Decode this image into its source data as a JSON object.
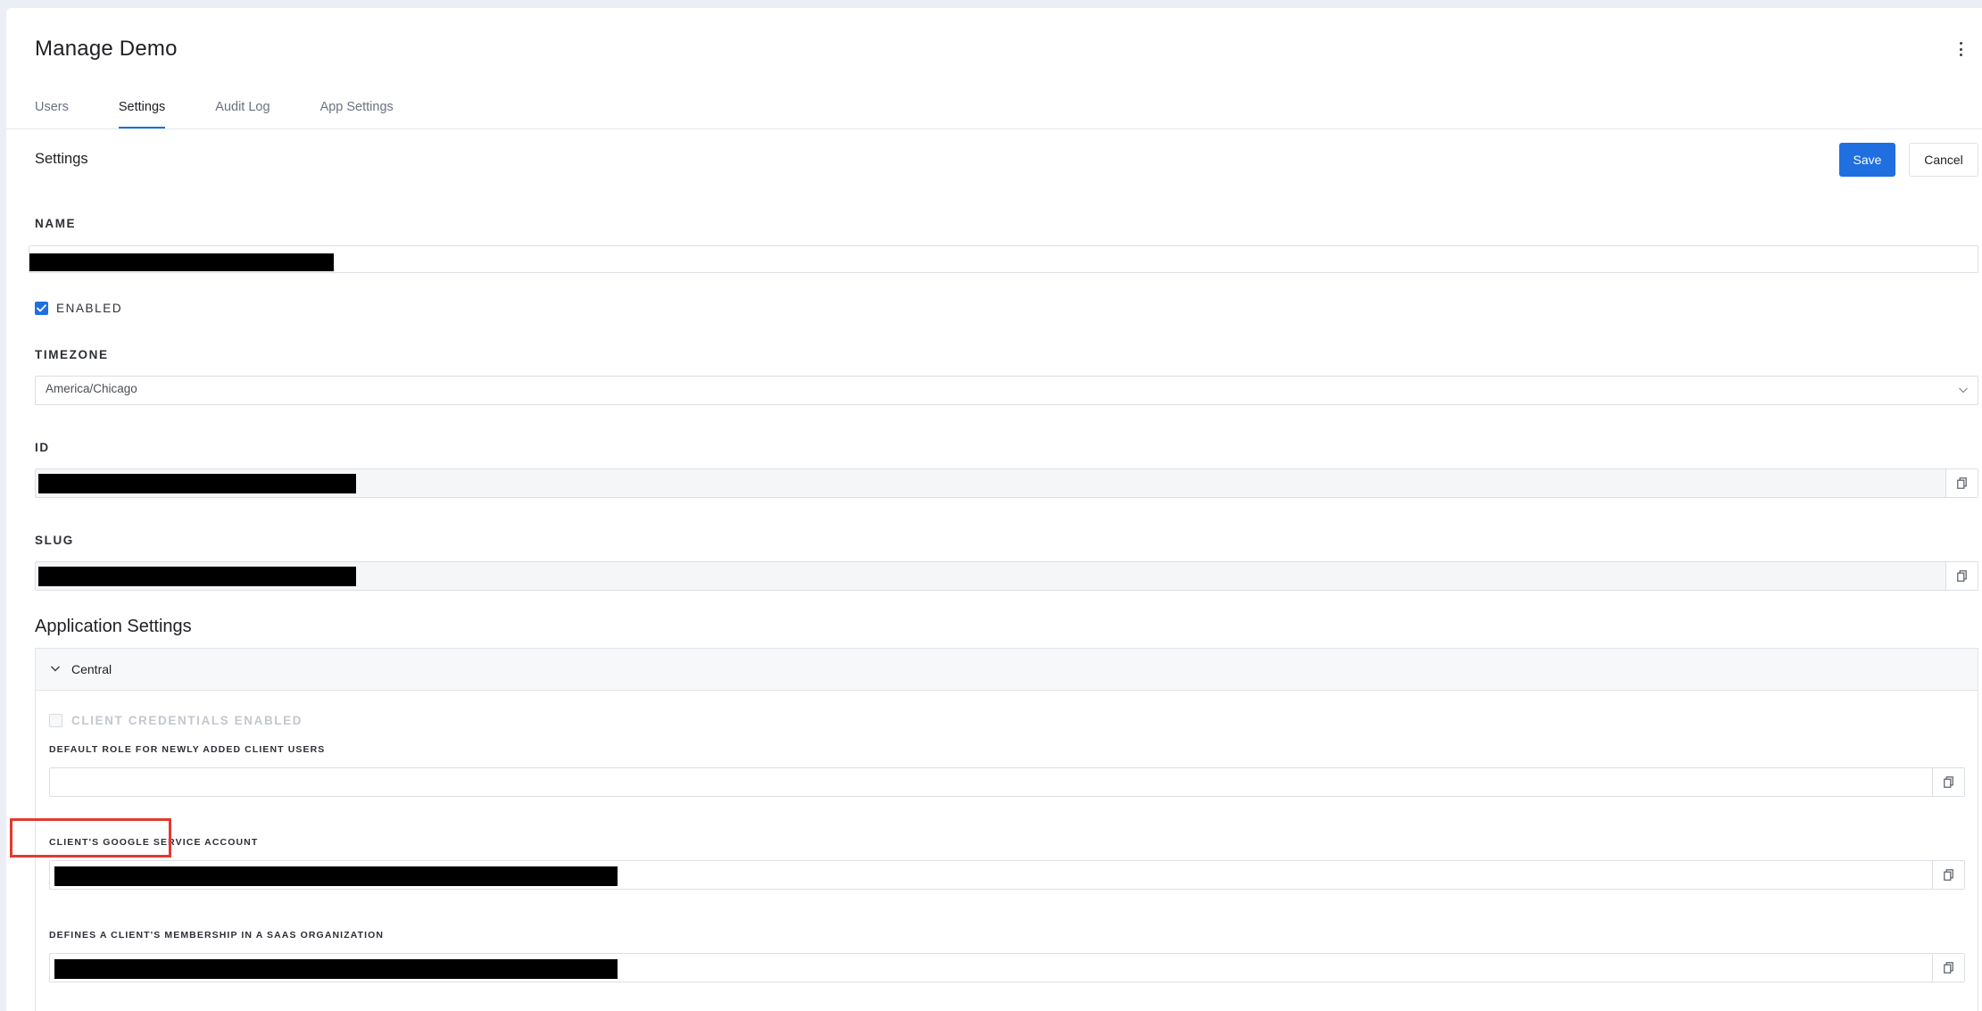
{
  "header": {
    "title": "Manage Demo",
    "more_icon": "kebab-vertical-icon"
  },
  "tabs": [
    {
      "label": "Users",
      "active": false
    },
    {
      "label": "Settings",
      "active": true
    },
    {
      "label": "Audit Log",
      "active": false
    },
    {
      "label": "App Settings",
      "active": false
    }
  ],
  "settings": {
    "title": "Settings",
    "save_label": "Save",
    "cancel_label": "Cancel",
    "name_label": "NAME",
    "enabled_label": "ENABLED",
    "enabled_checked": true,
    "timezone_label": "TIMEZONE",
    "timezone_value": "America/Chicago",
    "id_label": "ID",
    "slug_label": "SLUG"
  },
  "app_settings": {
    "title": "Application Settings",
    "panel": {
      "name": "Central",
      "expanded": true,
      "client_credentials_label": "CLIENT CREDENTIALS ENABLED",
      "client_credentials_checked": false,
      "default_role_label": "DEFAULT ROLE FOR NEWLY ADDED CLIENT USERS",
      "default_role_value": "",
      "google_service_account_label": "CLIENT'S GOOGLE SERVICE ACCOUNT",
      "saas_membership_label": "DEFINES A CLIENT'S MEMBERSHIP IN A SAAS ORGANIZATION"
    }
  },
  "colors": {
    "primary": "#1f6fe0",
    "highlight_border": "#e23a2e",
    "redaction": "#000000"
  }
}
